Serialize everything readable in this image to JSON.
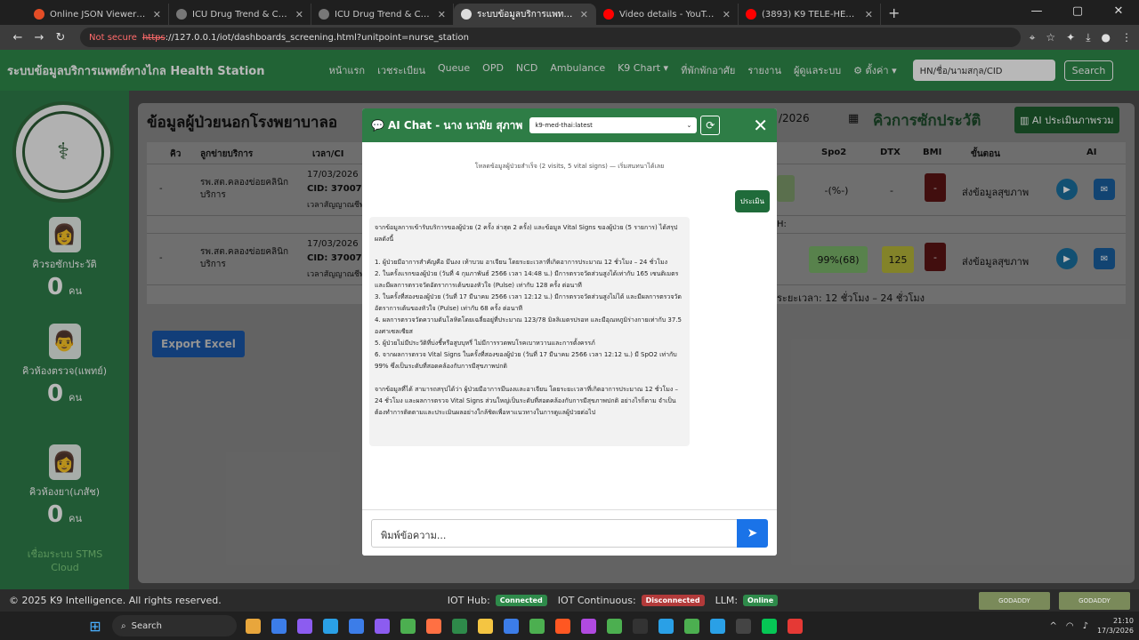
{
  "browser": {
    "tabs": [
      {
        "title": "Online JSON Viewer and Forma",
        "color": "#e44d26",
        "active": false
      },
      {
        "title": "ICU Drug Trend & Critical Care",
        "color": "#777777",
        "active": false
      },
      {
        "title": "ICU Drug Trend & Critical Care",
        "color": "#777777",
        "active": false
      },
      {
        "title": "ระบบข้อมูลบริการแพทย์ทางไกล Health Station",
        "color": "#dddddd",
        "active": true
      },
      {
        "title": "Video details - YouTube Studio",
        "color": "#ff0000",
        "active": false
      },
      {
        "title": "(3893) K9 TELE-HEALTH AI Ver",
        "color": "#ff0000",
        "active": false
      }
    ],
    "not_secure": "Not secure",
    "url_scheme": "https",
    "url_rest": "://127.0.0.1/iot/dashboards_screening.html?unitpoint=nurse_station"
  },
  "app": {
    "brand": "ระบบข้อมูลบริการแพทย์ทางไกล Health Station",
    "menu": [
      "หน้าแรก",
      "เวชระเบียน",
      "Queue",
      "OPD",
      "NCD",
      "Ambulance",
      "K9 Chart ▾",
      "ที่พักพักอาศัย",
      "รายงาน",
      "ผู้ดูแลระบบ",
      "⚙ ตั้งค่า ▾"
    ],
    "hn_search_placeholder": "HN/ชื่อ/นามสกุล/CID",
    "search_label": "Search"
  },
  "sidebar": {
    "queues": [
      {
        "label": "คิวรอซักประวัติ",
        "count": "0",
        "unit": "คน"
      },
      {
        "label": "คิวห้องตรวจ(แพทย์)",
        "count": "0",
        "unit": "คน"
      },
      {
        "label": "คิวห้องยา(เภสัช)",
        "count": "0",
        "unit": "คน"
      }
    ],
    "stms_text": "เชื่อมระบบ STMS Cloud"
  },
  "main": {
    "title": "ข้อมูลผู้ป่วยนอกโรงพยาบาลอ",
    "date_value": "/2026",
    "history_title": "คิวการซักประวัติ",
    "assess_label": "AI ประเมินภาพรวม",
    "headers": [
      "คิว",
      "ลูกข่ายบริการ",
      "เวลา/CI",
      "Spo2",
      "DTX",
      "BMI",
      "ขั้นตอน",
      "AI"
    ],
    "rows": [
      {
        "queue": "-",
        "unit": "รพ.สต.คลองข่อยคลินิกบริการ",
        "datetime": "17/03/2026 12",
        "cid": "CID: 3700700",
        "note": "เวลาสัญญาณชีพ",
        "spo2": "-(%-)",
        "dtx": "-",
        "bmi": "-",
        "step": "ส่งข้อมูลสุขภาพ"
      },
      {
        "queue": "-",
        "unit": "รพ.สต.คลองข่อยคลินิกบริการ",
        "datetime": "17/03/2026 12",
        "cid": "CID: 3700700",
        "note": "เวลาสัญญาณชีพ",
        "spo2": "99%(68)",
        "dtx": "125",
        "bmi": "-",
        "step": "ส่งข้อมูลสุขภาพ"
      }
    ],
    "side_note": "H:",
    "side_note2": "ระยะเวลา: 12 ชั่วโมง – 24 ชั่วโมง",
    "export_label": "Export Excel"
  },
  "chat": {
    "title": "AI Chat - นาง นามัย สุภาพ",
    "model": "k9-med-thai:latest",
    "system_msg": "โหลดข้อมูลผู้ป่วยสำเร็จ (2 visits, 5 vital signs) — เริ่มสนทนาได้เลย",
    "user_msg": "ประเมิน",
    "ai_lines": [
      "จากข้อมูลการเข้ารับบริการของผู้ป่วย (2 ครั้ง ล่าสุด 2 ครั้ง) และข้อมูล Vital Signs ของผู้ป่วย (5 รายการ) ได้สรุปผลดังนี้",
      "",
      "1. ผู้ป่วยมีอาการสำคัญคือ มึนงง เท้าบวม อาเจียน โดยระยะเวลาที่เกิดอาการประมาณ 12 ชั่วโมง – 24 ชั่วโมง",
      "2. ในครั้งแรกของผู้ป่วย (วันที่ 4 กุมภาพันธ์ 2566 เวลา 14:48 น.) มีการตรวจวัดส่วนสูงได้เท่ากับ 165 เซนติเมตร และมีผลการตรวจวัดอัตราการเต้นของหัวใจ (Pulse) เท่ากับ 128 ครั้ง ต่อนาที",
      "3. ในครั้งที่สองของผู้ป่วย (วันที่ 17 มีนาคม 2566 เวลา 12:12 น.) มีการตรวจวัดส่วนสูงไม่ได้ และมีผลการตรวจวัดอัตราการเต้นของหัวใจ (Pulse) เท่ากับ 68 ครั้ง ต่อนาที",
      "4. ผลการตรวจวัดความดันโลหิตโดยเฉลี่ยอยู่ที่ประมาณ 123/78 มิลลิเมตรปรอท และมีอุณหภูมิร่างกายเท่ากับ 37.5 องศาเซลเซียส",
      "5. ผู้ป่วยไม่มีประวัติที่บ่งชี้หรือสูบบุหรี่ ไม่มีการรวดพบโรคเบาหวานและการตั้งครรภ์",
      "6. จากผลการตรวจ Vital Signs ในครั้งที่สองของผู้ป่วย (วันที่ 17 มีนาคม 2566 เวลา 12:12 น.) มี SpO2 เท่ากับ 99% ซึ่งเป็นระดับที่สอดคล้องกับการมีสุขภาพปกติ",
      "",
      "จากข้อมูลที่ได้ สามารถสรุปได้ว่า ผู้ป่วยมีอาการมึนงงและอาเจียน โดยระยะเวลาที่เกิดอาการประมาณ 12 ชั่วโมง – 24 ชั่วโมง และผลการตรวจ Vital Signs ส่วนใหญ่เป็นระดับที่สอดคล้องกับการมีสุขภาพปกติ อย่างไรก็ตาม จำเป็นต้องทำการติดตามและประเมินผลอย่างใกล้ชิดเพื่อหาแนวทางในการดูแลผู้ป่วยต่อไป"
    ],
    "input_placeholder": "พิมพ์ข้อความ..."
  },
  "status": {
    "copyright": "© 2025 K9 Intelligence. All rights reserved.",
    "iot_hub_label": "IOT Hub:",
    "iot_hub_state": "Connected",
    "iot_cont_label": "IOT Continuous:",
    "iot_cont_state": "Disconnected",
    "llm_label": "LLM:",
    "llm_state": "Online",
    "badge": "GODADDY"
  },
  "taskbar": {
    "search": "Search",
    "time": "21:10",
    "date": "17/3/2026",
    "app_colors": [
      "#e8a63c",
      "#3c7de8",
      "#8c5cf0",
      "#2aa0e6",
      "#3c7de8",
      "#8c5cf0",
      "#4caf50",
      "#ff7043",
      "#2e8a4a",
      "#f4c542",
      "#3c7de8",
      "#4caf50",
      "#ff5722",
      "#b04ae0",
      "#4caf50",
      "#333333",
      "#2aa0e6",
      "#4caf50",
      "#2aa0e6",
      "#444444",
      "#06c755",
      "#e53935"
    ]
  }
}
